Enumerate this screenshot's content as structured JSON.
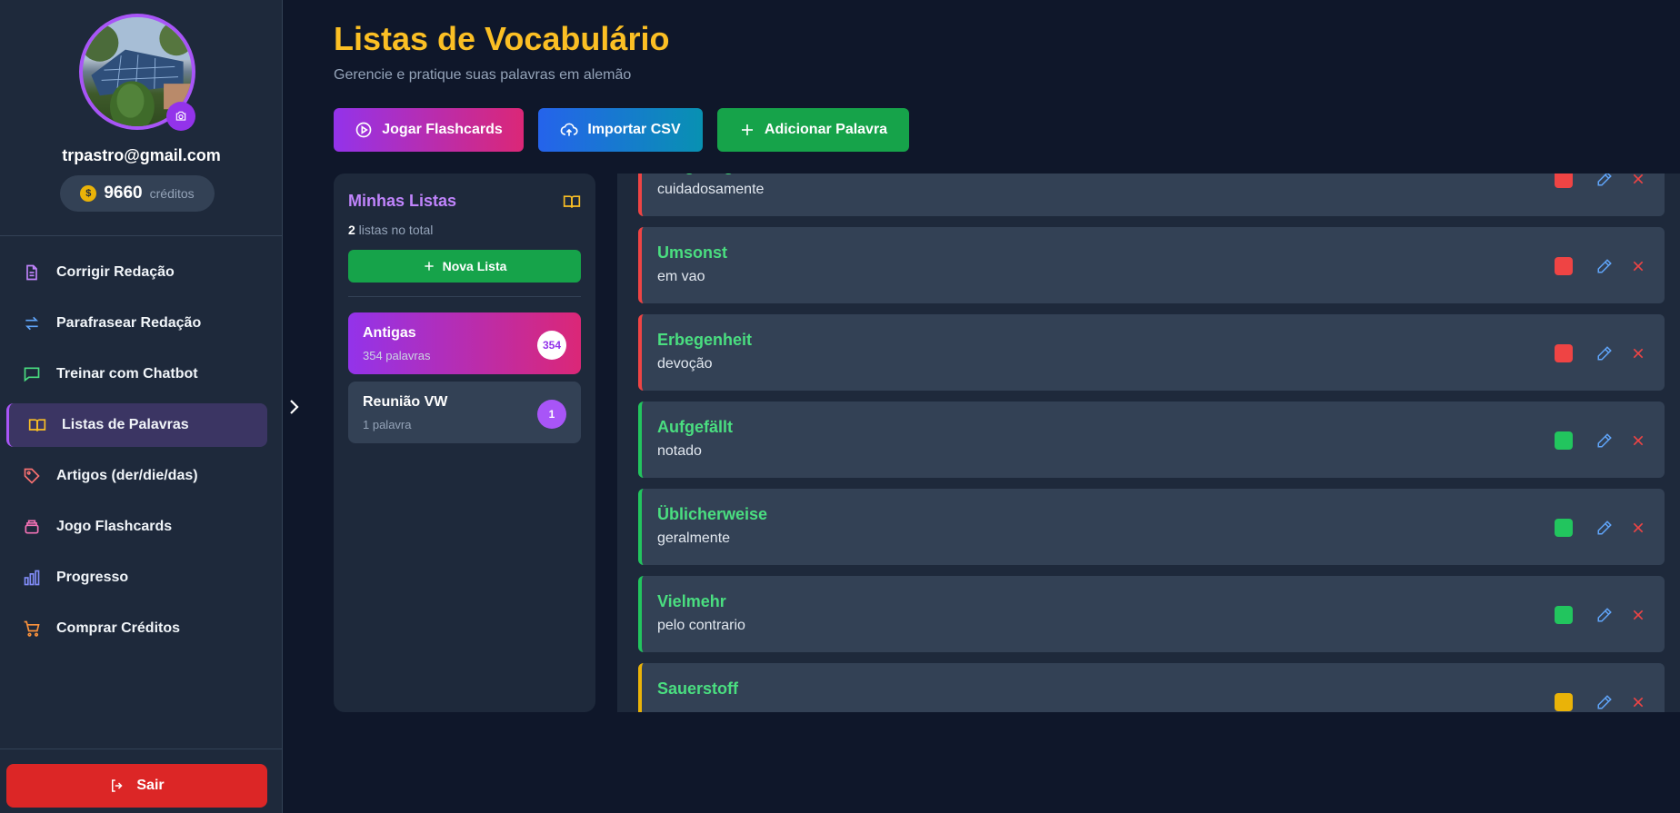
{
  "user": {
    "email": "trpastro@gmail.com",
    "credits": "9660",
    "credits_label": "créditos"
  },
  "nav": [
    {
      "label": "Corrigir Redação",
      "icon": "document-icon",
      "color": "#c084fc"
    },
    {
      "label": "Parafrasear Redação",
      "icon": "swap-arrows-icon",
      "color": "#60a5fa"
    },
    {
      "label": "Treinar com Chatbot",
      "icon": "chat-icon",
      "color": "#4ade80"
    },
    {
      "label": "Listas de Palavras",
      "icon": "book-icon",
      "color": "#fbbf24",
      "active": true
    },
    {
      "label": "Artigos (der/die/das)",
      "icon": "tag-icon",
      "color": "#f87171"
    },
    {
      "label": "Jogo Flashcards",
      "icon": "cards-icon",
      "color": "#f472b6"
    },
    {
      "label": "Progresso",
      "icon": "bar-chart-icon",
      "color": "#818cf8"
    },
    {
      "label": "Comprar Créditos",
      "icon": "cart-icon",
      "color": "#fb923c"
    }
  ],
  "logout_label": "Sair",
  "page": {
    "title": "Listas de Vocabulário",
    "subtitle": "Gerencie e pratique suas palavras em alemão"
  },
  "actions": {
    "flashcards": "Jogar Flashcards",
    "import": "Importar CSV",
    "add": "Adicionar Palavra"
  },
  "lists_panel": {
    "title": "Minhas Listas",
    "count": "2",
    "count_label": " listas no total",
    "new_list": "Nova Lista",
    "lists": [
      {
        "name": "Antigas",
        "sub": "354 palavras",
        "badge": "354"
      },
      {
        "name": "Reunião VW",
        "sub": "1 palavra",
        "badge": "1"
      }
    ]
  },
  "words": [
    {
      "de": "Sorgfältig",
      "pt": "cuidadosamente",
      "status": "#ef4444",
      "border": "#ef4444"
    },
    {
      "de": "Umsonst",
      "pt": "em vao",
      "status": "#ef4444",
      "border": "#ef4444"
    },
    {
      "de": "Erbegenheit",
      "pt": "devoção",
      "status": "#ef4444",
      "border": "#ef4444"
    },
    {
      "de": "Aufgefällt",
      "pt": "notado",
      "status": "#22c55e",
      "border": "#22c55e"
    },
    {
      "de": "Üblicherweise",
      "pt": "geralmente",
      "status": "#22c55e",
      "border": "#22c55e"
    },
    {
      "de": "Vielmehr",
      "pt": "pelo contrario",
      "status": "#22c55e",
      "border": "#22c55e"
    },
    {
      "de": "Sauerstoff",
      "pt": "",
      "status": "#eab308",
      "border": "#eab308"
    }
  ]
}
